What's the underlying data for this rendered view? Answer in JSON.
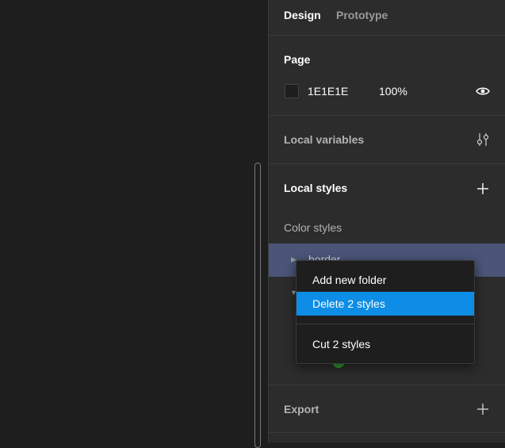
{
  "tabs": {
    "design": "Design",
    "prototype": "Prototype"
  },
  "page": {
    "title": "Page",
    "color": "1E1E1E",
    "opacity": "100%",
    "visibility_icon": "eye-icon"
  },
  "local_variables": {
    "title": "Local variables",
    "icon": "sliders-icon"
  },
  "local_styles": {
    "title": "Local styles",
    "add_icon": "plus-icon"
  },
  "color_styles": {
    "title": "Color styles",
    "items": [
      {
        "label": "border",
        "expanded": false,
        "selected": true
      },
      {
        "label": "",
        "expanded": true,
        "selected": false
      }
    ],
    "swatch_color": "#2e9e2e"
  },
  "export": {
    "title": "Export",
    "add_icon": "plus-icon"
  },
  "context_menu": {
    "items": [
      {
        "label": "Add new folder",
        "active": false
      },
      {
        "label": "Delete 2 styles",
        "active": true
      },
      {
        "label": "Cut 2 styles",
        "active": false
      }
    ],
    "highlight_color": "#0d8de5"
  },
  "colors": {
    "canvas": "#1e1e1e",
    "panel": "#2c2c2c",
    "selection": "#4a5578"
  }
}
